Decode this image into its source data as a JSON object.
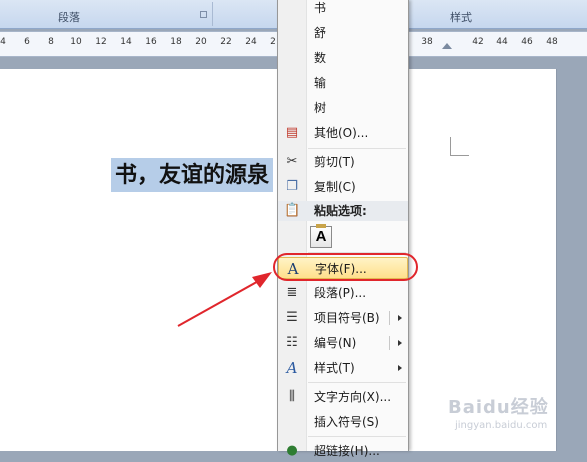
{
  "ribbon": {
    "group_paragraph": "段落",
    "group_styles": "样式"
  },
  "ruler": {
    "ticks": [
      "4",
      "6",
      "8",
      "10",
      "12",
      "14",
      "16",
      "18",
      "20",
      "22",
      "24",
      "2",
      "38",
      "42",
      "44",
      "46",
      "48"
    ]
  },
  "document": {
    "selected_text": "书，友谊的源泉"
  },
  "watermark": {
    "brand": "Baidu经验",
    "url": "jingyan.baidu.com"
  },
  "menu": {
    "candidates": [
      "书",
      "舒",
      "数",
      "输",
      "树"
    ],
    "other": "其他(O)...",
    "cut": "剪切(T)",
    "copy": "复制(C)",
    "paste_options": "粘贴选项:",
    "paste_keep_text": "A",
    "font": "字体(F)...",
    "paragraph": "段落(P)...",
    "bullets": "项目符号(B)",
    "numbering": "编号(N)",
    "styles": "样式(T)",
    "text_direction": "文字方向(X)...",
    "insert_symbol": "插入符号(S)",
    "hyperlink": "超链接(H)..."
  },
  "colors": {
    "highlight": "#ffe08c",
    "annotation": "#e0262c",
    "selection": "#b6cde8"
  }
}
